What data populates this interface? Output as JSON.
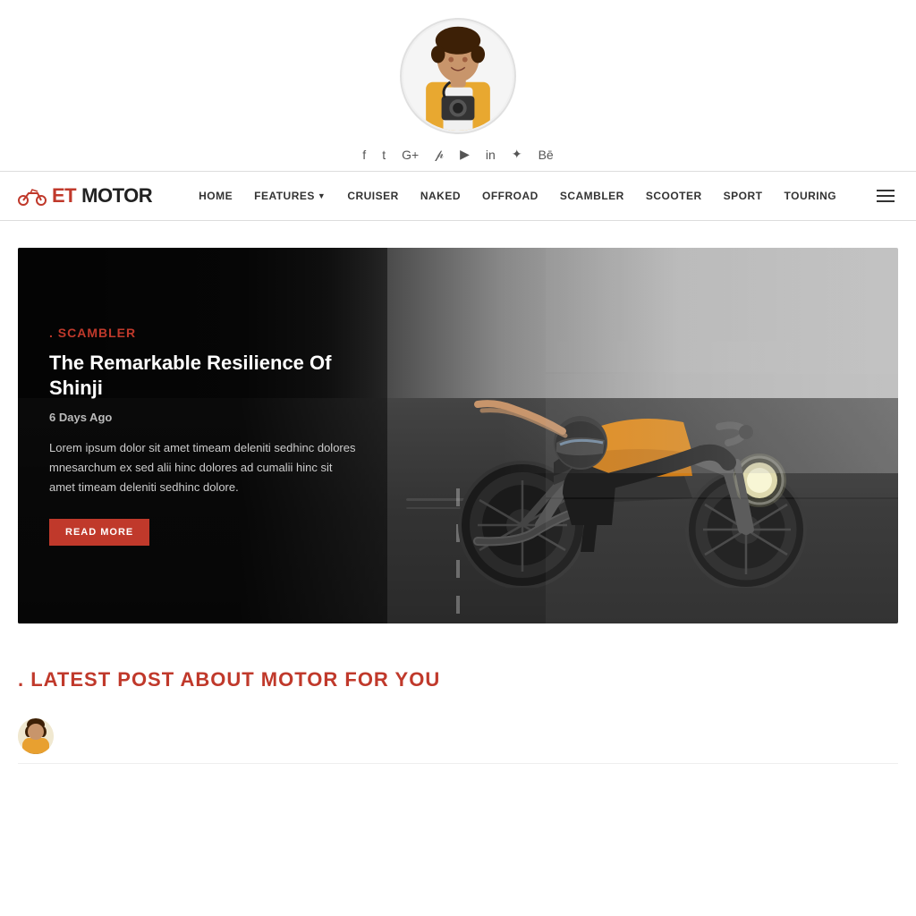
{
  "site": {
    "logo_et": "ET",
    "logo_motor": " MOTOR",
    "tagline": "ET MOTOR"
  },
  "social_icons": [
    {
      "name": "facebook",
      "symbol": "f",
      "label": "Facebook"
    },
    {
      "name": "twitter",
      "symbol": "𝕥",
      "label": "Twitter"
    },
    {
      "name": "google-plus",
      "symbol": "G+",
      "label": "Google Plus"
    },
    {
      "name": "pinterest",
      "symbol": "𝓅",
      "label": "Pinterest"
    },
    {
      "name": "youtube",
      "symbol": "▶",
      "label": "YouTube"
    },
    {
      "name": "linkedin",
      "symbol": "in",
      "label": "LinkedIn"
    },
    {
      "name": "rss",
      "symbol": "✦",
      "label": "RSS"
    },
    {
      "name": "behance",
      "symbol": "Bē",
      "label": "Behance"
    }
  ],
  "nav": {
    "items": [
      {
        "label": "HOME",
        "active": false
      },
      {
        "label": "FEATURES",
        "active": false,
        "has_dropdown": true
      },
      {
        "label": "CRUISER",
        "active": false
      },
      {
        "label": "NAKED",
        "active": false
      },
      {
        "label": "OFFROAD",
        "active": false
      },
      {
        "label": "SCAMBLER",
        "active": false
      },
      {
        "label": "SCOOTER",
        "active": false
      },
      {
        "label": "SPORT",
        "active": false
      },
      {
        "label": "TOURING",
        "active": false
      }
    ]
  },
  "hero": {
    "category": "SCAMBLER",
    "title": "The Remarkable Resilience Of Shinji",
    "date": "6 Days Ago",
    "excerpt": "Lorem ipsum dolor sit amet timeam deleniti sedhinc dolores mnesarchum ex sed alii hinc dolores ad cumalii hinc sit amet timeam deleniti sedhinc dolore.",
    "cta_label": "READ MORE"
  },
  "latest_section": {
    "title": "LATEST POST ABOUT MOTOR FOR YOU"
  }
}
